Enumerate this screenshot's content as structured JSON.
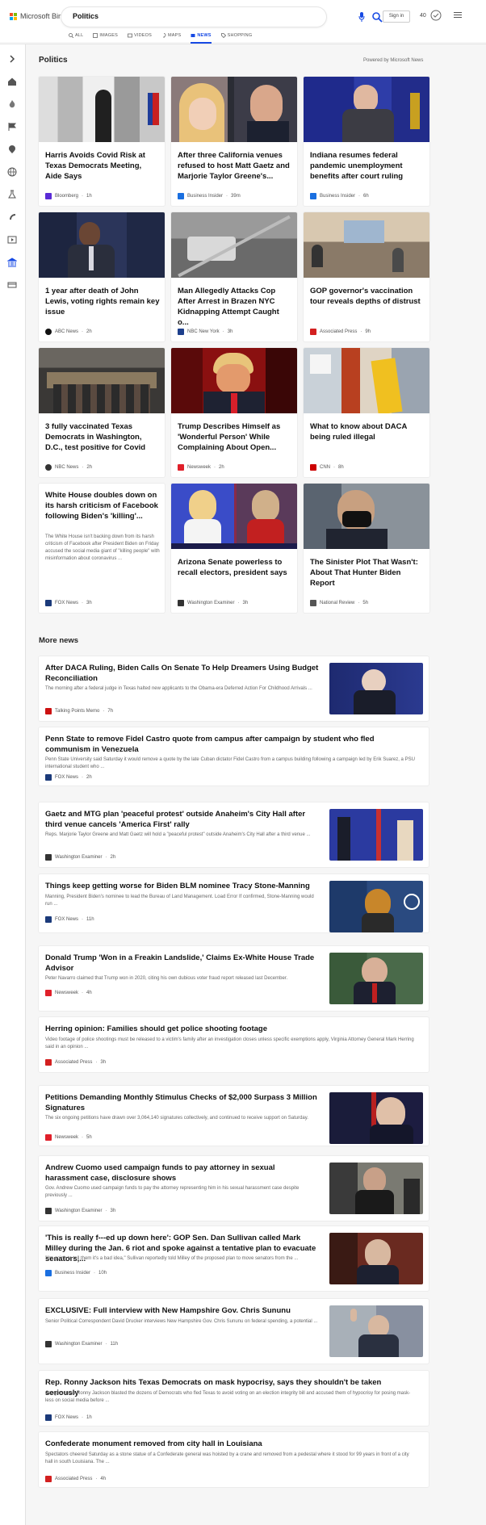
{
  "brand": {
    "name": "Microsoft Bing"
  },
  "search": {
    "value": "Politics"
  },
  "header": {
    "signin": "Sign in",
    "points": "40"
  },
  "tabs": [
    {
      "label": "ALL",
      "icon": "search-icon"
    },
    {
      "label": "IMAGES",
      "icon": "image-icon"
    },
    {
      "label": "VIDEOS",
      "icon": "video-icon"
    },
    {
      "label": "MAPS",
      "icon": "map-icon"
    },
    {
      "label": "NEWS",
      "icon": "news-icon",
      "active": true
    },
    {
      "label": "SHOPPING",
      "icon": "tag-icon"
    }
  ],
  "section": {
    "title": "Politics",
    "powered": "Powered by Microsoft News"
  },
  "cards": [
    {
      "title": "Harris Avoids Covid Risk at Texas Democrats Meeting, Aide Says",
      "source": "Bloomberg",
      "time": "1h",
      "favicon_color": "#5a2bd6"
    },
    {
      "title": "After three California venues refused to host Matt Gaetz and Marjorie Taylor Greene's...",
      "source": "Business Insider",
      "time": "39m",
      "favicon_color": "#1a6fe0"
    },
    {
      "title": "Indiana resumes federal pandemic unemployment benefits after court ruling",
      "source": "Business Insider",
      "time": "6h",
      "favicon_color": "#1a6fe0"
    },
    {
      "title": "1 year after death of John Lewis, voting rights remain key issue",
      "source": "ABC News",
      "time": "2h",
      "favicon_color": "#111111"
    },
    {
      "title": "Man Allegedly Attacks Cop After Arrest in Brazen NYC Kidnapping Attempt Caught o...",
      "source": "NBC New York",
      "time": "3h",
      "favicon_color": "#1d3f8c"
    },
    {
      "title": "GOP governor's vaccination tour reveals depths of distrust",
      "source": "Associated Press",
      "time": "9h",
      "favicon_color": "#d32020"
    },
    {
      "title": "3 fully vaccinated Texas Democrats in Washington, D.C., test positive for Covid",
      "source": "NBC News",
      "time": "2h",
      "favicon_color": "#333333"
    },
    {
      "title": "Trump Describes Himself as 'Wonderful Person' While Complaining About Open...",
      "source": "Newsweek",
      "time": "2h",
      "favicon_color": "#e0202a"
    },
    {
      "title": "What to know about DACA being ruled illegal",
      "source": "CNN",
      "time": "8h",
      "favicon_color": "#cc0000"
    },
    {
      "title": "White House doubles down on its harsh criticism of Facebook following Biden's 'killing'...",
      "desc": "The White House isn't backing down from its harsh criticism of Facebook after President Biden on Friday accused the social media giant of \"killing people\" with misinformation about coronavirus ...",
      "source": "FOX News",
      "time": "3h",
      "favicon_color": "#1b3a7a"
    },
    {
      "title": "Arizona Senate powerless to recall electors, president says",
      "source": "Washington Examiner",
      "time": "3h",
      "favicon_color": "#333333"
    },
    {
      "title": "The Sinister Plot That Wasn't: About That Hunter Biden Report",
      "source": "National Review",
      "time": "5h",
      "favicon_color": "#555555"
    }
  ],
  "more": {
    "title": "More news",
    "items": [
      {
        "title": "After DACA Ruling, Biden Calls On Senate To Help Dreamers Using Budget Reconciliation",
        "desc": "The morning after a federal judge in Texas halted new applicants to the Obama-era Deferred Action For Childhood Arrivals ...",
        "source": "Talking Points Memo",
        "time": "7h",
        "favicon_color": "#cc1111"
      },
      {
        "title": "Penn State to remove Fidel Castro quote from campus after campaign by student who fled communism in Venezuela",
        "desc": "Penn State University said Saturday it would remove a quote by the late Cuban dictator Fidel Castro from a campus building following a campaign led by Erik Suarez, a PSU international student who ...",
        "source": "FOX News",
        "time": "2h",
        "favicon_color": "#1b3a7a"
      },
      {
        "title": "Gaetz and MTG plan 'peaceful protest' outside Anaheim's City Hall after third venue cancels 'America First' rally",
        "desc": "Reps. Marjorie Taylor Greene and Matt Gaetz will hold a \"peaceful protest\" outside Anaheim's City Hall after a third venue ...",
        "source": "Washington Examiner",
        "time": "2h",
        "favicon_color": "#333333"
      },
      {
        "title": "Things keep getting worse for Biden BLM nominee Tracy Stone-Manning",
        "desc": "Manning, President Biden's nominee to lead the Bureau of Land Management.  Load Error If confirmed, Stone-Manning would run ...",
        "source": "FOX News",
        "time": "11h",
        "favicon_color": "#1b3a7a"
      },
      {
        "title": "Donald Trump 'Won in a Freakin Landslide,' Claims Ex-White House Trade Advisor",
        "desc": "Peter Navarro claimed that Trump won in 2020, citing his own dubious voter fraud report released last December.",
        "source": "Newsweek",
        "time": "4h",
        "favicon_color": "#e0202a"
      },
      {
        "title": "Herring opinion: Families should get police shooting footage",
        "desc": "Video footage of police shootings must be released to a victim's family after an investigation closes unless specific exemptions apply, Virginia Attorney General Mark Herring said in an opinion ...",
        "source": "Associated Press",
        "time": "3h",
        "favicon_color": "#d32020"
      },
      {
        "title": "Petitions Demanding Monthly Stimulus Checks of $2,000 Surpass 3 Million Signatures",
        "desc": "The six ongoing petitions have drawn over 3,064,140 signatures collectively, and continued to receive support on Saturday.",
        "source": "Newsweek",
        "time": "5h",
        "favicon_color": "#e0202a"
      },
      {
        "title": "Andrew Cuomo used campaign funds to pay attorney in sexual harassment case, disclosure shows",
        "desc": "Gov. Andrew Cuomo used campaign funds to pay the attorney representing him in his sexual harassment case despite previously ...",
        "source": "Washington Examiner",
        "time": "3h",
        "favicon_color": "#333333"
      },
      {
        "title": "'This is really f---ed up down here': GOP Sen. Dan Sullivan called Mark Milley during the Jan. 6 riot and spoke against a tentative plan to evacuate senators,...",
        "desc": "\"I'm going to tell them it's a bad idea,\" Sullivan reportedly told Milley of the proposed plan to move senators from the ...",
        "source": "Business Insider",
        "time": "10h",
        "favicon_color": "#1a6fe0"
      },
      {
        "title": "EXCLUSIVE: Full interview with New Hampshire Gov. Chris Sununu",
        "desc": "Senior Political Correspondent David Drucker interviews New Hampshire Gov. Chris Sununu on federal spending, a potential ...",
        "source": "Washington Examiner",
        "time": "11h",
        "favicon_color": "#333333"
      },
      {
        "title": "Rep. Ronny Jackson hits Texas Democrats on mask hypocrisy, says they shouldn't be taken seriously",
        "desc": "Congressman Ronny Jackson blasted the dozens of Democrats who fled Texas to avoid voting on an election integrity bill and accused them of hypocrisy for posing mask-less on social media before ...",
        "source": "FOX News",
        "time": "1h",
        "favicon_color": "#1b3a7a"
      },
      {
        "title": "Confederate monument removed from city hall in Louisiana",
        "desc": "Spectators cheered Saturday as a stone statue of a Confederate general was hoisted by a crane and removed from a pedestal where it stood for 99 years in front of a city hall in south Louisiana.  The ...",
        "source": "Associated Press",
        "time": "4h",
        "favicon_color": "#d32020"
      }
    ]
  },
  "sidebar_icons": [
    "chevron-right-icon",
    "home-icon",
    "fire-icon",
    "flag-icon",
    "location-icon",
    "globe-icon",
    "science-icon",
    "rocket-icon",
    "entertainment-icon",
    "politics-icon",
    "money-icon"
  ],
  "colors": {
    "accent": "#174ae4",
    "logo": [
      "#f25022",
      "#7fba00",
      "#00a4ef",
      "#ffb900"
    ]
  }
}
